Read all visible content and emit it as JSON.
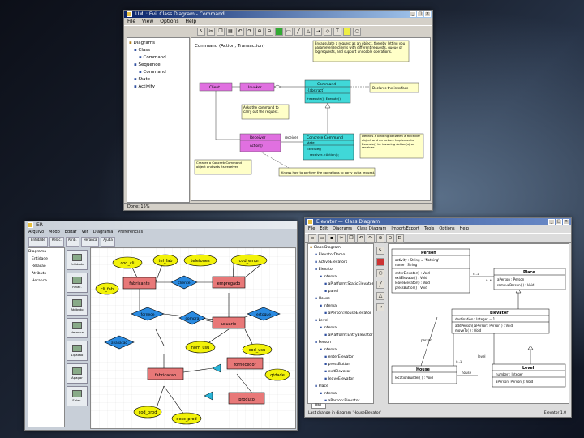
{
  "win1": {
    "title": "UML: Evil Class Diagram - Command",
    "menu": [
      "File",
      "View",
      "Options",
      "Help"
    ],
    "tree": [
      {
        "label": "Diagrams",
        "indent": 0
      },
      {
        "label": "Class",
        "indent": 1
      },
      {
        "label": "Command",
        "indent": 2
      },
      {
        "label": "Sequence",
        "indent": 1
      },
      {
        "label": "Command",
        "indent": 2
      },
      {
        "label": "State",
        "indent": 1
      },
      {
        "label": "Activity",
        "indent": 1
      }
    ],
    "diagram_title": "Command (Action, Transaction)",
    "note_top": "Encapsulate a request as an object, thereby letting you parameterize clients with different requests, queue or log requests, and support undoable operations.",
    "client": "Client",
    "invoker": "Invoker",
    "command": "Command",
    "command_stereo": "{abstract}",
    "command_op": "+execute(): Execute()",
    "declares": "Declares the interface",
    "asks": "Asks the command to carry out the request.",
    "receiver": "Receiver",
    "receiver_op": "Action()",
    "receiver_label": "receiver",
    "concrete": "Concrete Command",
    "concrete_attr": "state",
    "concrete_op1": "Execute()",
    "concrete_op2": "receiver->Action();",
    "defines": "Defines a binding between a Receiver object and an action. Implements Execute() by invoking Action(s) on receiver.",
    "creates": "Creates a ConcreteCommand object and sets its receiver.",
    "knows": "Knows how to perform the operations to carry out a request.",
    "status": "Done: 15%"
  },
  "win2": {
    "title": "ER",
    "menu": [
      "Arquivo",
      "Modo",
      "Editar",
      "Ver",
      "Diagrama",
      "Preferencias"
    ],
    "toolbar": [
      "Entidade",
      "Relac.",
      "Atrib.",
      "Heranca",
      "Ajuda"
    ],
    "palette": [
      "Entidade",
      "Relac.",
      "Atributo",
      "Heranca",
      "Ligacao",
      "Apagar",
      "Selec."
    ],
    "tree_root": "Diagrama",
    "tree_items": [
      "Entidade",
      "Relacao",
      "Atributo",
      "Heranca"
    ],
    "attr_1": "cod_cli",
    "attr_2": "tel_fab",
    "attr_3": "telefones",
    "attr_4": "cod_empr",
    "attr_5": "cli_fab",
    "entity_1": "fabricante",
    "rel_1": "cliente",
    "entity_2": "empregado",
    "rel_2": "fornece",
    "entity_3": "usuario",
    "rel_3": "compra",
    "rel_4": "estoque",
    "attr_6": "nom_usu",
    "attr_7": "cod_usu",
    "entity_4": "fabricacao",
    "entity_5": "fornecedor",
    "attr_8": "qtdade",
    "entity_6": "produto",
    "attr_9": "cod_prod",
    "attr_10": "desc_prod",
    "rel_5": "avaliacao"
  },
  "win3": {
    "title": "Elevator — Class Diagram",
    "menu": [
      "File",
      "Edit",
      "Diagrams",
      "Class Diagram",
      "Import/Export",
      "Tools",
      "Options",
      "Help"
    ],
    "tree": [
      {
        "label": "Class Diagram",
        "indent": 0
      },
      {
        "label": "ElevatorDemo",
        "indent": 1
      },
      {
        "label": "ActiveElevators",
        "indent": 1
      },
      {
        "label": "Elevator",
        "indent": 1
      },
      {
        "label": "internal",
        "indent": 2
      },
      {
        "label": "aPlatform:StaticElevator",
        "indent": 3
      },
      {
        "label": "panel",
        "indent": 3
      },
      {
        "label": "House",
        "indent": 1
      },
      {
        "label": "internal",
        "indent": 2
      },
      {
        "label": "aPerson:HouseElevator",
        "indent": 3
      },
      {
        "label": "Level",
        "indent": 1
      },
      {
        "label": "internal",
        "indent": 2
      },
      {
        "label": "aPlatform:EntryElevator",
        "indent": 3
      },
      {
        "label": "Person",
        "indent": 1
      },
      {
        "label": "internal",
        "indent": 2
      },
      {
        "label": "enterElevator",
        "indent": 3
      },
      {
        "label": "pressButton",
        "indent": 3
      },
      {
        "label": "exitElevator",
        "indent": 3
      },
      {
        "label": "leaveElevator",
        "indent": 3
      },
      {
        "label": "Place",
        "indent": 1
      },
      {
        "label": "internal",
        "indent": 2
      },
      {
        "label": "aPerson:Elevator",
        "indent": 3
      }
    ],
    "tab_label": "UML",
    "person": "Person",
    "person_fields": [
      "activity : String = 'Nothing'",
      "name : String"
    ],
    "person_ops": [
      "enterElevator() : Void",
      "exitElevator() : Void",
      "leaveElevator() : Void",
      "pressButton() : Void"
    ],
    "place": "Place",
    "place_ops": [
      "aPerson : Person",
      "removePerson( ) : Void"
    ],
    "elevator": "Elevator",
    "elevator_fields": [
      "destination : Integer = 1"
    ],
    "elevator_ops": [
      "addPerson( aPerson: Person ) : Void",
      "moveTo( ) : Void"
    ],
    "house": "House",
    "house_ops": [
      "locationBuilder( ) : Void"
    ],
    "level": "Level",
    "level_fields": [
      "number : Integer"
    ],
    "level_ops": [
      "aPerson: Person(): Void"
    ],
    "mult_1": "0..1",
    "mult_2": "0..*",
    "mult_3": "0..1",
    "role_1": "person",
    "role_2": "level",
    "role_3": "house",
    "status": "Last change in diagram 'HouseElevator'",
    "status_right": "Elevator 1.0"
  }
}
